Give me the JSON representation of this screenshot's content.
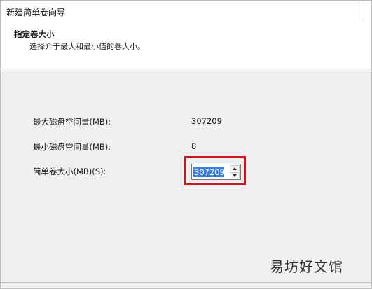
{
  "window": {
    "title": "新建简单卷向导"
  },
  "header": {
    "title": "指定卷大小",
    "subtitle": "选择介于最大和最小值的卷大小。"
  },
  "fields": {
    "max_label": "最大磁盘空间量(MB):",
    "max_value": "307209",
    "min_label": "最小磁盘空间量(MB):",
    "min_value": "8",
    "size_label": "简单卷大小(MB)(S):",
    "size_value": "307209"
  },
  "icons": {
    "spin_up": "chevron-up-icon",
    "spin_down": "chevron-down-icon"
  },
  "watermark": {
    "text": "易坊好文馆"
  },
  "colors": {
    "highlight": "#c8171e",
    "selection": "#3d7cd6",
    "background": "#f0f0f0"
  }
}
